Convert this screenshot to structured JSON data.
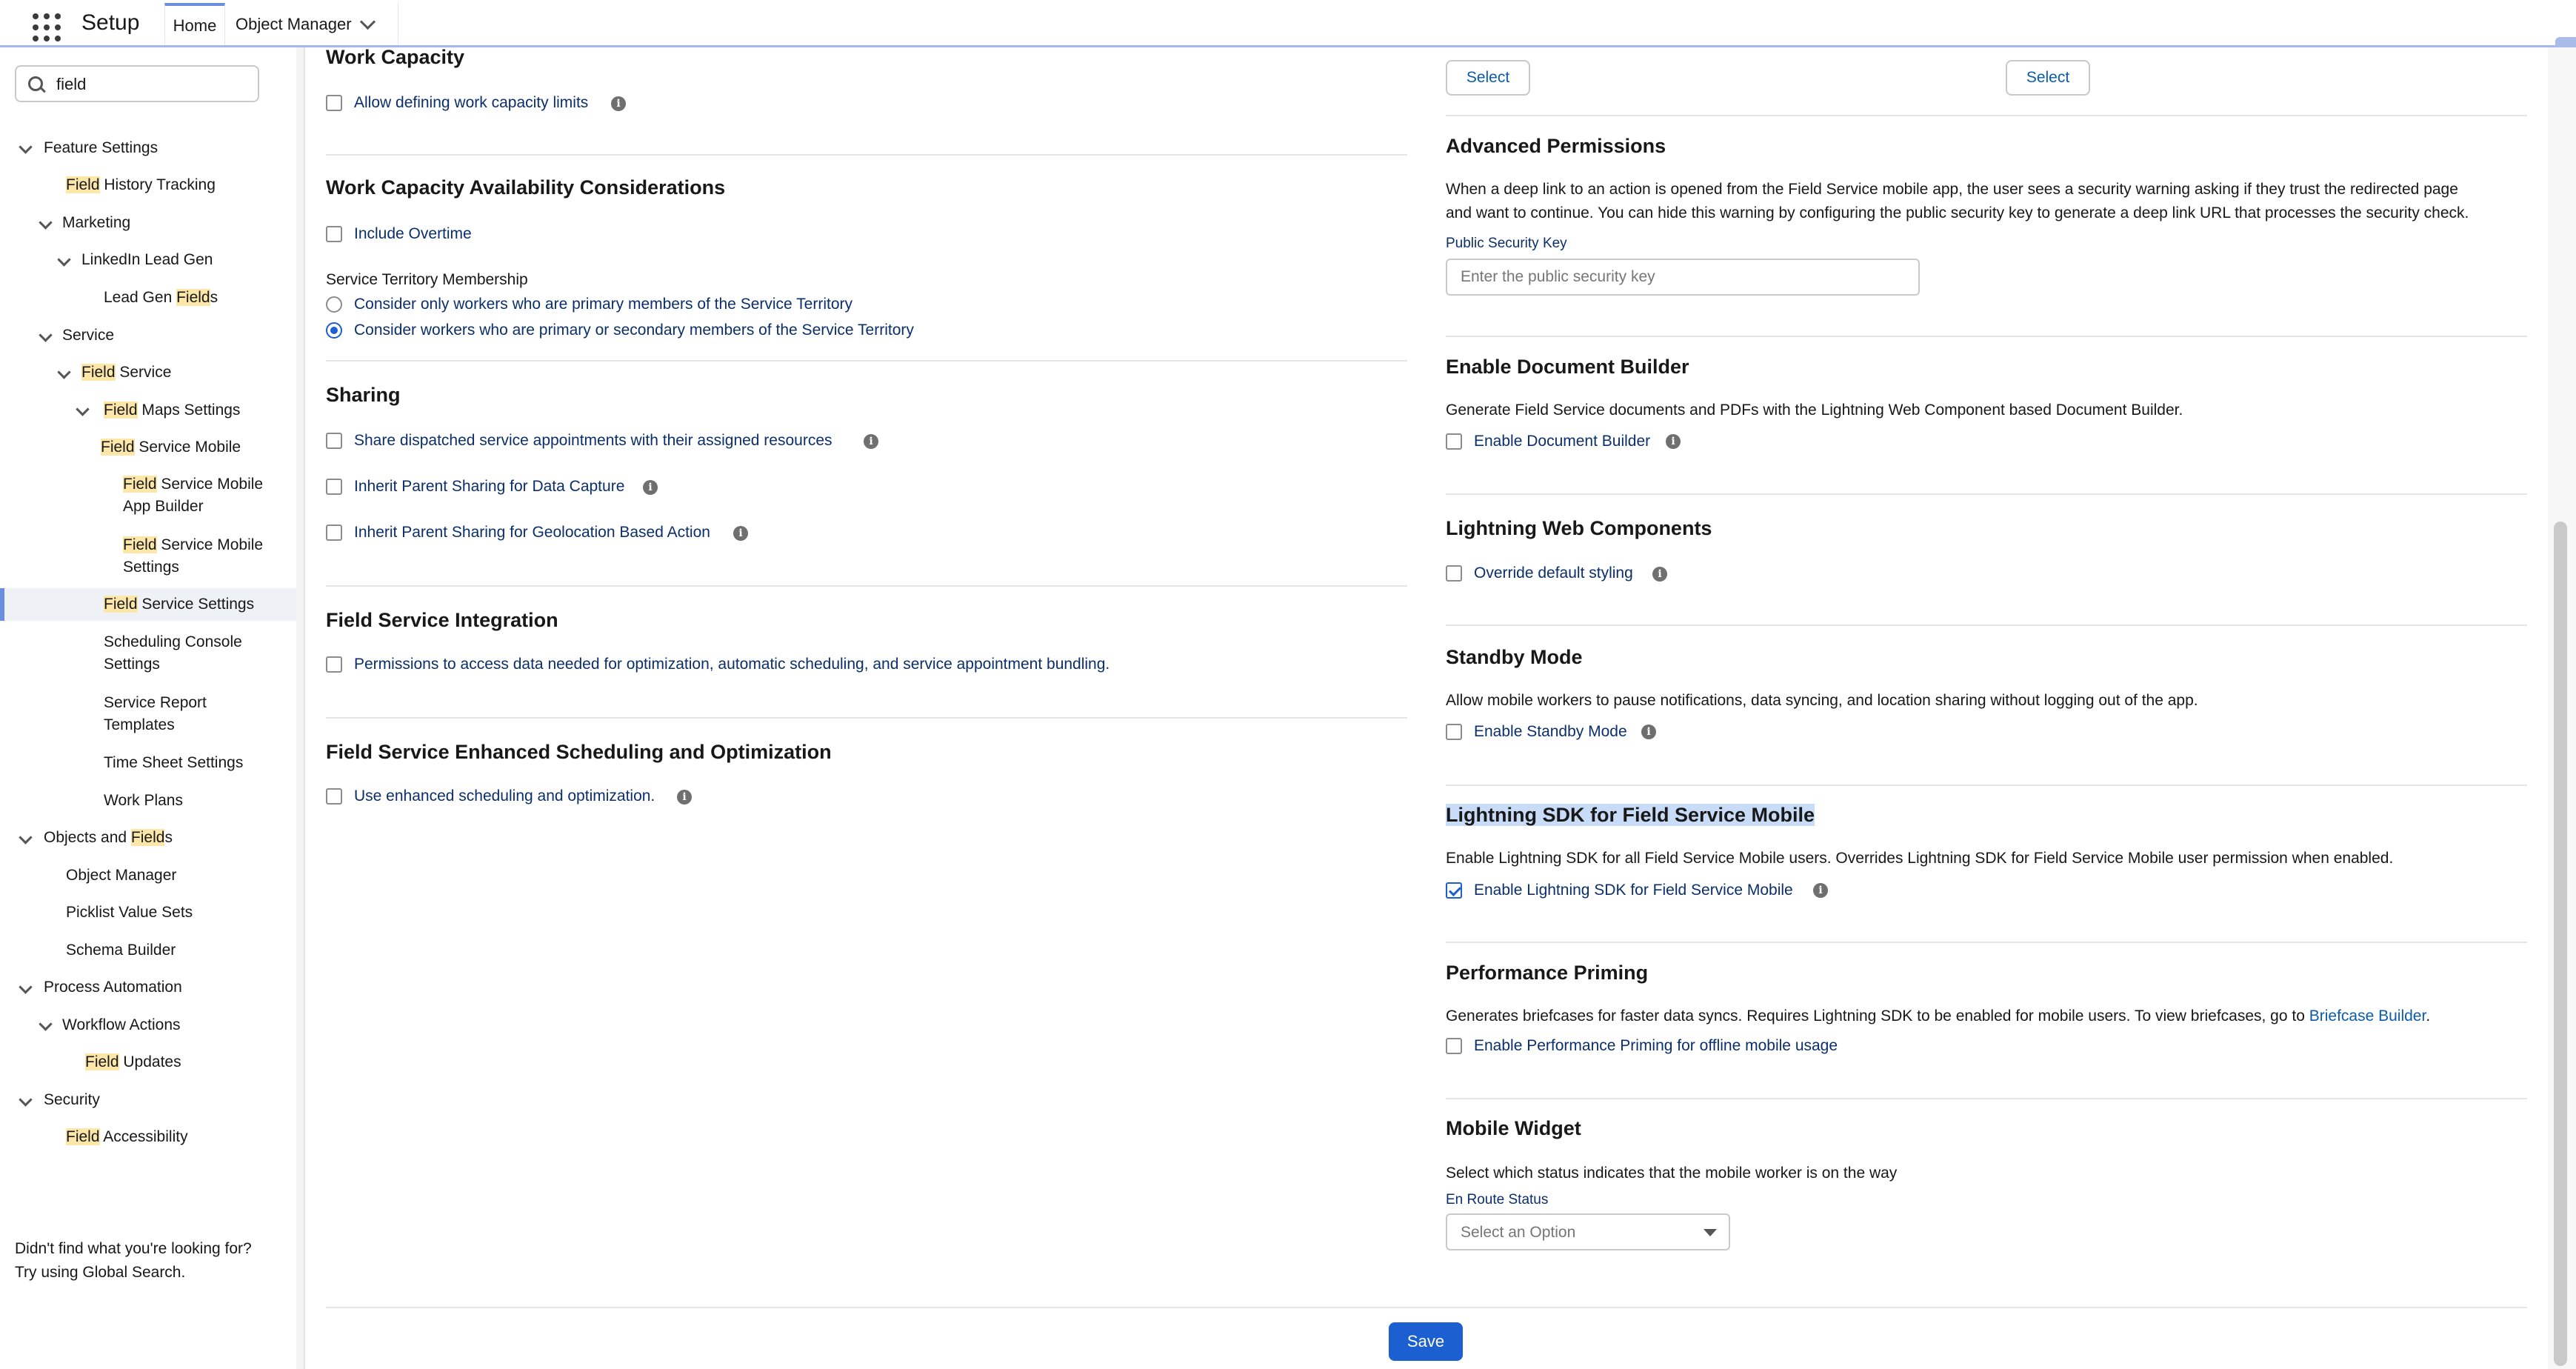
{
  "topbar": {
    "app_name": "Setup",
    "tabs": [
      {
        "label": "Home"
      },
      {
        "label": "Object Manager"
      }
    ]
  },
  "sidebar": {
    "search_value": "field",
    "tree": [
      {
        "pre": "",
        "hl": "",
        "post": "Feature Settings"
      },
      {
        "pre": "",
        "hl": "Field",
        "post": " History Tracking"
      },
      {
        "pre": "",
        "hl": "",
        "post": "Marketing"
      },
      {
        "pre": "",
        "hl": "",
        "post": "LinkedIn Lead Gen"
      },
      {
        "pre": "Lead Gen ",
        "hl": "Field",
        "post": "s"
      },
      {
        "pre": "",
        "hl": "",
        "post": "Service"
      },
      {
        "pre": "",
        "hl": "Field",
        "post": " Service"
      },
      {
        "pre": "",
        "hl": "Field",
        "post": " Maps Settings"
      },
      {
        "pre": "",
        "hl": "Field",
        "post": " Service Mobile"
      },
      {
        "pre": "",
        "hl": "Field",
        "post": " Service Mobile",
        "line2": "App Builder"
      },
      {
        "pre": "",
        "hl": "Field",
        "post": " Service Mobile",
        "line2": "Settings"
      },
      {
        "pre": "",
        "hl": "Field",
        "post": " Service Settings"
      },
      {
        "pre": "",
        "hl": "",
        "post": "Scheduling Console",
        "line2": "Settings"
      },
      {
        "pre": "",
        "hl": "",
        "post": "Service Report",
        "line2": "Templates"
      },
      {
        "pre": "",
        "hl": "",
        "post": "Time Sheet Settings"
      },
      {
        "pre": "",
        "hl": "",
        "post": "Work Plans"
      },
      {
        "pre": "Objects and ",
        "hl": "Field",
        "post": "s"
      },
      {
        "pre": "",
        "hl": "",
        "post": "Object Manager"
      },
      {
        "pre": "",
        "hl": "",
        "post": "Picklist Value Sets"
      },
      {
        "pre": "",
        "hl": "",
        "post": "Schema Builder"
      },
      {
        "pre": "",
        "hl": "",
        "post": "Process Automation"
      },
      {
        "pre": "",
        "hl": "",
        "post": "Workflow Actions"
      },
      {
        "pre": "",
        "hl": "Field",
        "post": " Updates"
      },
      {
        "pre": "",
        "hl": "",
        "post": "Security"
      },
      {
        "pre": "",
        "hl": "Field",
        "post": " Accessibility"
      }
    ],
    "footer_line1": "Didn't find what you're looking for?",
    "footer_line2": "Try using Global Search."
  },
  "left": {
    "work_capacity": {
      "title": "Work Capacity",
      "opt1": "Allow defining work capacity limits"
    },
    "availability": {
      "title": "Work Capacity Availability Considerations",
      "opt1": "Include Overtime",
      "group_label": "Service Territory Membership",
      "radio1": "Consider only workers who are primary members of the Service Territory",
      "radio2": "Consider workers who are primary or secondary members of the Service Territory"
    },
    "sharing": {
      "title": "Sharing",
      "opt1": "Share dispatched service appointments with their assigned resources",
      "opt2": "Inherit Parent Sharing for Data Capture",
      "opt3": "Inherit Parent Sharing for Geolocation Based Action"
    },
    "integration": {
      "title": "Field Service Integration",
      "opt1": "Permissions to access data needed for optimization, automatic scheduling, and service appointment bundling."
    },
    "enhanced": {
      "title": "Field Service Enhanced Scheduling and Optimization",
      "opt1": "Use enhanced scheduling and optimization."
    }
  },
  "right": {
    "select_label_1": "Select",
    "select_label_2": "Select",
    "advanced": {
      "title": "Advanced Permissions",
      "desc1": "When a deep link to an action is opened from the Field Service mobile app, the user sees a security warning asking if they trust the redirected page",
      "desc2": "and want to continue. You can hide this warning by configuring the public security key to generate a deep link URL that processes the security check.",
      "key_label": "Public Security Key",
      "key_placeholder": "Enter the public security key"
    },
    "docbuilder": {
      "title": "Enable Document Builder",
      "desc": "Generate Field Service documents and PDFs with the Lightning Web Component based Document Builder.",
      "opt1": "Enable Document Builder"
    },
    "lwc": {
      "title": "Lightning Web Components",
      "opt1": "Override default styling"
    },
    "standby": {
      "title": "Standby Mode",
      "desc": "Allow mobile workers to pause notifications, data syncing, and location sharing without logging out of the app.",
      "opt1": "Enable Standby Mode"
    },
    "sdk": {
      "title": "Lightning SDK for Field Service Mobile",
      "desc": "Enable Lightning SDK for all Field Service Mobile users. Overrides Lightning SDK for Field Service Mobile user permission when enabled.",
      "opt1": "Enable Lightning SDK for Field Service Mobile"
    },
    "priming": {
      "title": "Performance Priming",
      "desc": "Generates briefcases for faster data syncs. Requires Lightning SDK to be enabled for mobile users. To view briefcases, go to ",
      "link": "Briefcase Builder",
      "desc_end": ".",
      "opt1": "Enable Performance Priming for offline mobile usage"
    },
    "widget": {
      "title": "Mobile Widget",
      "desc": "Select which status indicates that the mobile worker is on the way",
      "status_label": "En Route Status",
      "status_value": "Select an Option"
    }
  },
  "save_label": "Save"
}
